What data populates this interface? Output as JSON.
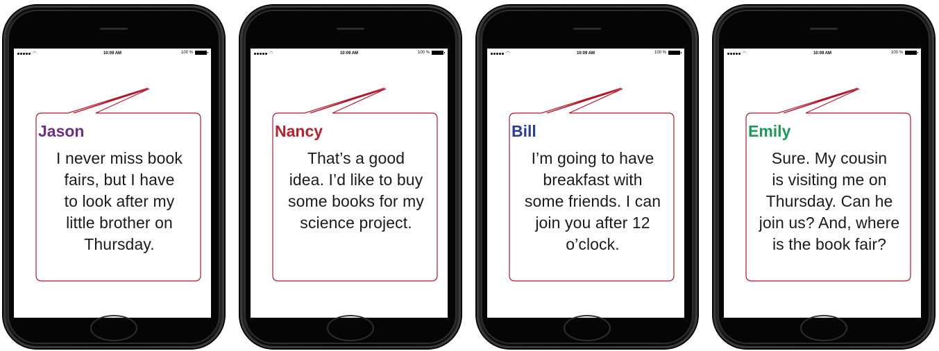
{
  "phones": [
    {
      "status": {
        "time": "10:09 AM",
        "battery": "100 %"
      },
      "speaker": "Jason",
      "speaker_color": "#6b2f84",
      "message": "I never miss book\nfairs, but I have\nto look after my\nlittle brother on\nThursday."
    },
    {
      "status": {
        "time": "10:09 AM",
        "battery": "100 %"
      },
      "speaker": "Nancy",
      "speaker_color": "#b9202e",
      "message": "That’s a good\nidea. I’d like to buy\nsome books for my\nscience project."
    },
    {
      "status": {
        "time": "10:09 AM",
        "battery": "100 %"
      },
      "speaker": "Bill",
      "speaker_color": "#2b3f8f",
      "message": "I’m going to have\nbreakfast with\nsome friends. I can\njoin you after 12\no’clock."
    },
    {
      "status": {
        "time": "10:09 AM",
        "battery": "100 %"
      },
      "speaker": "Emily",
      "speaker_color": "#1a9a54",
      "message": "Sure. My cousin\nis visiting me on\nThursday. Can he\njoin us? And, where\nis the book fair?"
    }
  ],
  "colors": {
    "bubble_border": "#b2182b"
  }
}
